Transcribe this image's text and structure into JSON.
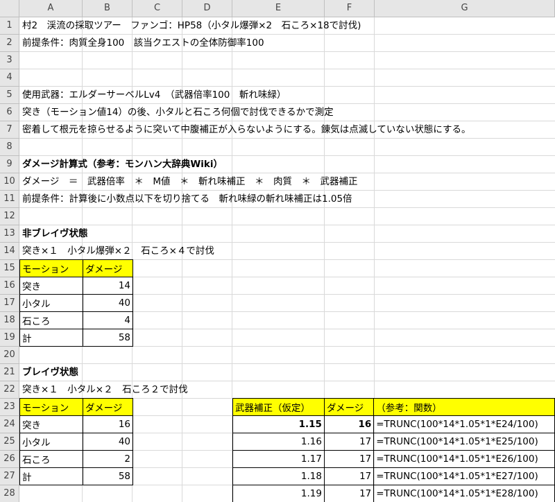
{
  "columns": [
    "A",
    "B",
    "C",
    "D",
    "E",
    "F",
    "G"
  ],
  "rows": [
    "1",
    "2",
    "3",
    "4",
    "5",
    "6",
    "7",
    "8",
    "9",
    "10",
    "11",
    "12",
    "13",
    "14",
    "15",
    "16",
    "17",
    "18",
    "19",
    "20",
    "21",
    "22",
    "23",
    "24",
    "25",
    "26",
    "27",
    "28"
  ],
  "lines": {
    "r1": "村2　渓流の採取ツアー　ファンゴ：HP58（小タル爆弾×2　石ころ×18で討伐)",
    "r2": "前提条件：肉質全身100　該当クエストの全体防御率100",
    "r5": "使用武器：エルダーサーベルLv4　（武器倍率100　斬れ味緑）",
    "r6": "突き（モーション値14）の後、小タルと石ころ何個で討伐できるかで測定",
    "r7": "密着して根元を掠らせるように突いて中腹補正が入らないようにする。錬気は点滅していない状態にする。",
    "r9": "ダメージ計算式（参考：モンハン大辞典Wiki）",
    "r10": "ダメージ　＝　武器倍率　＊　M値　＊　斬れ味補正　＊　肉質　＊　武器補正",
    "r11": "前提条件：計算後に小数点以下を切り捨てる　斬れ味緑の斬れ味補正は1.05倍",
    "r13": "非ブレイヴ状態",
    "r14": "突き×１　小タル爆弾×２　石ころ×４で討伐",
    "r21": "ブレイヴ状態",
    "r22": "突き×１　小タル×２　石ころ２で討伐"
  },
  "table1": {
    "headers": [
      "モーション",
      "ダメージ"
    ],
    "rows": [
      {
        "motion": "突き",
        "damage": "14"
      },
      {
        "motion": "小タル",
        "damage": "40"
      },
      {
        "motion": "石ころ",
        "damage": "4"
      },
      {
        "motion": "計",
        "damage": "58"
      }
    ]
  },
  "table2": {
    "headers": [
      "モーション",
      "ダメージ"
    ],
    "rows": [
      {
        "motion": "突き",
        "damage": "16"
      },
      {
        "motion": "小タル",
        "damage": "40"
      },
      {
        "motion": "石ころ",
        "damage": "2"
      },
      {
        "motion": "計",
        "damage": "58"
      }
    ]
  },
  "table3": {
    "headers": [
      "武器補正（仮定）",
      "ダメージ",
      "（参考：関数）"
    ],
    "rows": [
      {
        "mod": "1.15",
        "damage": "16",
        "formula": "=TRUNC(100*14*1.05*1*E24/100)"
      },
      {
        "mod": "1.16",
        "damage": "17",
        "formula": "=TRUNC(100*14*1.05*1*E25/100)"
      },
      {
        "mod": "1.17",
        "damage": "17",
        "formula": "=TRUNC(100*14*1.05*1*E26/100)"
      },
      {
        "mod": "1.18",
        "damage": "17",
        "formula": "=TRUNC(100*14*1.05*1*E27/100)"
      },
      {
        "mod": "1.19",
        "damage": "17",
        "formula": "=TRUNC(100*14*1.05*1*E28/100)"
      }
    ]
  },
  "colors": {
    "header_fill": "#ffff00",
    "grid": "#d9d9d9",
    "header_bg": "#e6e6e6"
  }
}
